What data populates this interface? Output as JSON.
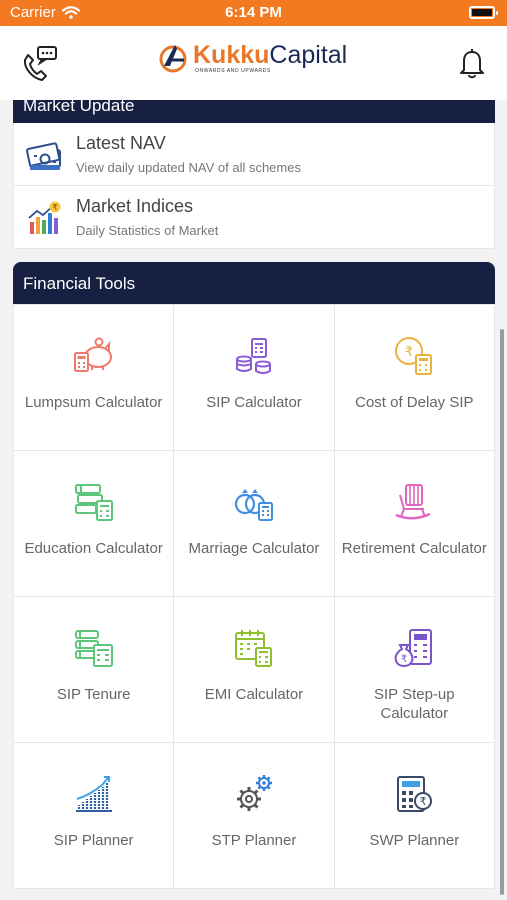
{
  "status_bar": {
    "carrier": "Carrier",
    "time": "6:14 PM"
  },
  "header": {
    "brand_primary": "Kukku",
    "brand_secondary": "Capital",
    "tagline": "ONWARDS AND UPWARDS",
    "left_icon": "phone-chat-icon",
    "right_icon": "bell-icon"
  },
  "market_update": {
    "title": "Market Update",
    "items": [
      {
        "title": "Latest NAV",
        "subtitle": "View daily updated NAV of all schemes",
        "icon": "banknotes-icon"
      },
      {
        "title": "Market Indices",
        "subtitle": "Daily Statistics of Market",
        "icon": "bar-chart-rupee-icon"
      }
    ]
  },
  "financial_tools": {
    "title": "Financial Tools",
    "items": [
      {
        "label": "Lumpsum Calculator",
        "icon": "piggy-bank-icon",
        "color": "#f07a6a"
      },
      {
        "label": "SIP Calculator",
        "icon": "coins-calculator-icon",
        "color": "#8a5cd6"
      },
      {
        "label": "Cost of Delay SIP",
        "icon": "rupee-clock-calculator-icon",
        "color": "#e8b33c"
      },
      {
        "label": "Education Calculator",
        "icon": "books-calculator-icon",
        "color": "#5cc77a"
      },
      {
        "label": "Marriage Calculator",
        "icon": "rings-calculator-icon",
        "color": "#3f8ee0"
      },
      {
        "label": "Retirement Calculator",
        "icon": "rocking-chair-icon",
        "color": "#e065c0"
      },
      {
        "label": "SIP Tenure",
        "icon": "list-calculator-icon",
        "color": "#5cc77a"
      },
      {
        "label": "EMI Calculator",
        "icon": "calendar-calculator-icon",
        "color": "#8fbf2e"
      },
      {
        "label": "SIP Step-up Calculator",
        "icon": "money-bag-calculator-icon",
        "color": "#7a55c9"
      },
      {
        "label": "SIP Planner",
        "icon": "growth-bars-icon",
        "color": "#2f5f9e"
      },
      {
        "label": "STP Planner",
        "icon": "gears-icon",
        "color": "#2f7fd6"
      },
      {
        "label": "SWP Planner",
        "icon": "calculator-rupee-icon",
        "color": "#3a4a66"
      }
    ]
  }
}
